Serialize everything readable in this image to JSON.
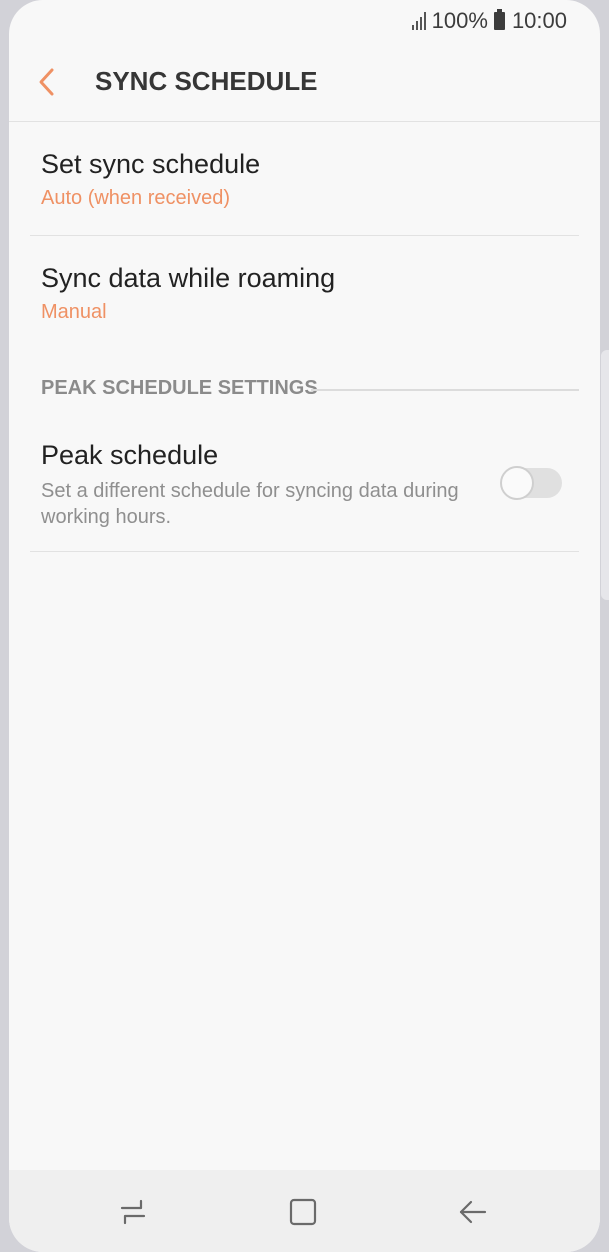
{
  "status_bar": {
    "battery_percent": "100%",
    "time": "10:00",
    "icons": [
      "signal-icon",
      "battery-icon"
    ]
  },
  "app_bar": {
    "title": "SYNC SCHEDULE",
    "back_icon": "chevron-left-icon"
  },
  "settings": {
    "items": [
      {
        "title": "Set sync schedule",
        "value": "Auto (when received)"
      },
      {
        "title": "Sync data while roaming",
        "value": "Manual"
      }
    ],
    "section_header": "PEAK SCHEDULE SETTINGS",
    "peak": {
      "title": "Peak schedule",
      "description": "Set a different schedule for syncing data during working hours.",
      "enabled": false
    }
  },
  "nav_bar": {
    "buttons": [
      "recents-icon",
      "home-icon",
      "back-icon"
    ]
  },
  "colors": {
    "accent": "#ef9164",
    "background": "#f8f8f8",
    "title_text": "#363636"
  }
}
